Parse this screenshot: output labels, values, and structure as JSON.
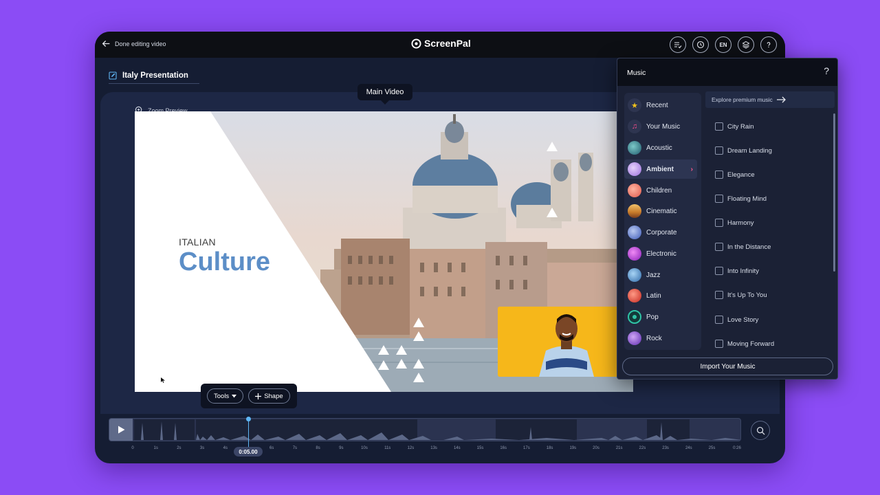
{
  "topbar": {
    "back_label": "Done editing video",
    "logo_text": "ScreenPal",
    "language": "EN"
  },
  "project": {
    "title": "Italy Presentation"
  },
  "stage": {
    "zoom_preview_label": "Zoom Preview",
    "main_video_label": "Main Video",
    "slide": {
      "kicker": "ITALIAN",
      "headline": "Culture"
    }
  },
  "toolbar": {
    "tools_label": "Tools",
    "shape_label": "Shape"
  },
  "timeline": {
    "current_time": "0:05.00",
    "ticks": [
      "0",
      "1s",
      "2s",
      "3s",
      "4s",
      "5s",
      "6s",
      "7s",
      "8s",
      "9s",
      "10s",
      "11s",
      "12s",
      "13s",
      "14s",
      "15s",
      "16s",
      "17s",
      "18s",
      "19s",
      "20s",
      "21s",
      "22s",
      "23s",
      "24s",
      "25s",
      "0:26"
    ]
  },
  "music_panel": {
    "title": "Music",
    "help": "?",
    "explore_label": "Explore premium music",
    "genres": [
      {
        "label": "Recent",
        "icon": "star-icon",
        "color": "#f1c21b"
      },
      {
        "label": "Your Music",
        "icon": "note-icon",
        "color": "#ff4d8d"
      },
      {
        "label": "Acoustic",
        "icon": "acoustic-icon",
        "color": "#3fa1a6"
      },
      {
        "label": "Ambient",
        "icon": "ambient-icon",
        "color": "#c9a2f2"
      },
      {
        "label": "Children",
        "icon": "children-icon",
        "color": "#f7746a"
      },
      {
        "label": "Cinematic",
        "icon": "cinematic-icon",
        "color": "#e5a43a"
      },
      {
        "label": "Corporate",
        "icon": "corporate-icon",
        "color": "#5a7bd6"
      },
      {
        "label": "Electronic",
        "icon": "electronic-icon",
        "color": "#c13fe0"
      },
      {
        "label": "Jazz",
        "icon": "jazz-icon",
        "color": "#4d8fcf"
      },
      {
        "label": "Latin",
        "icon": "latin-icon",
        "color": "#e8473b"
      },
      {
        "label": "Pop",
        "icon": "pop-icon",
        "color": "#2fc4a6"
      },
      {
        "label": "Rock",
        "icon": "rock-icon",
        "color": "#8a4fd8"
      }
    ],
    "active_genre": "Ambient",
    "tracks": [
      "City Rain",
      "Dream Landing",
      "Elegance",
      "Floating Mind",
      "Harmony",
      "In the Distance",
      "Into Infinity",
      "It's Up To You",
      "Love Story",
      "Moving Forward"
    ],
    "import_label": "Import Your Music"
  }
}
